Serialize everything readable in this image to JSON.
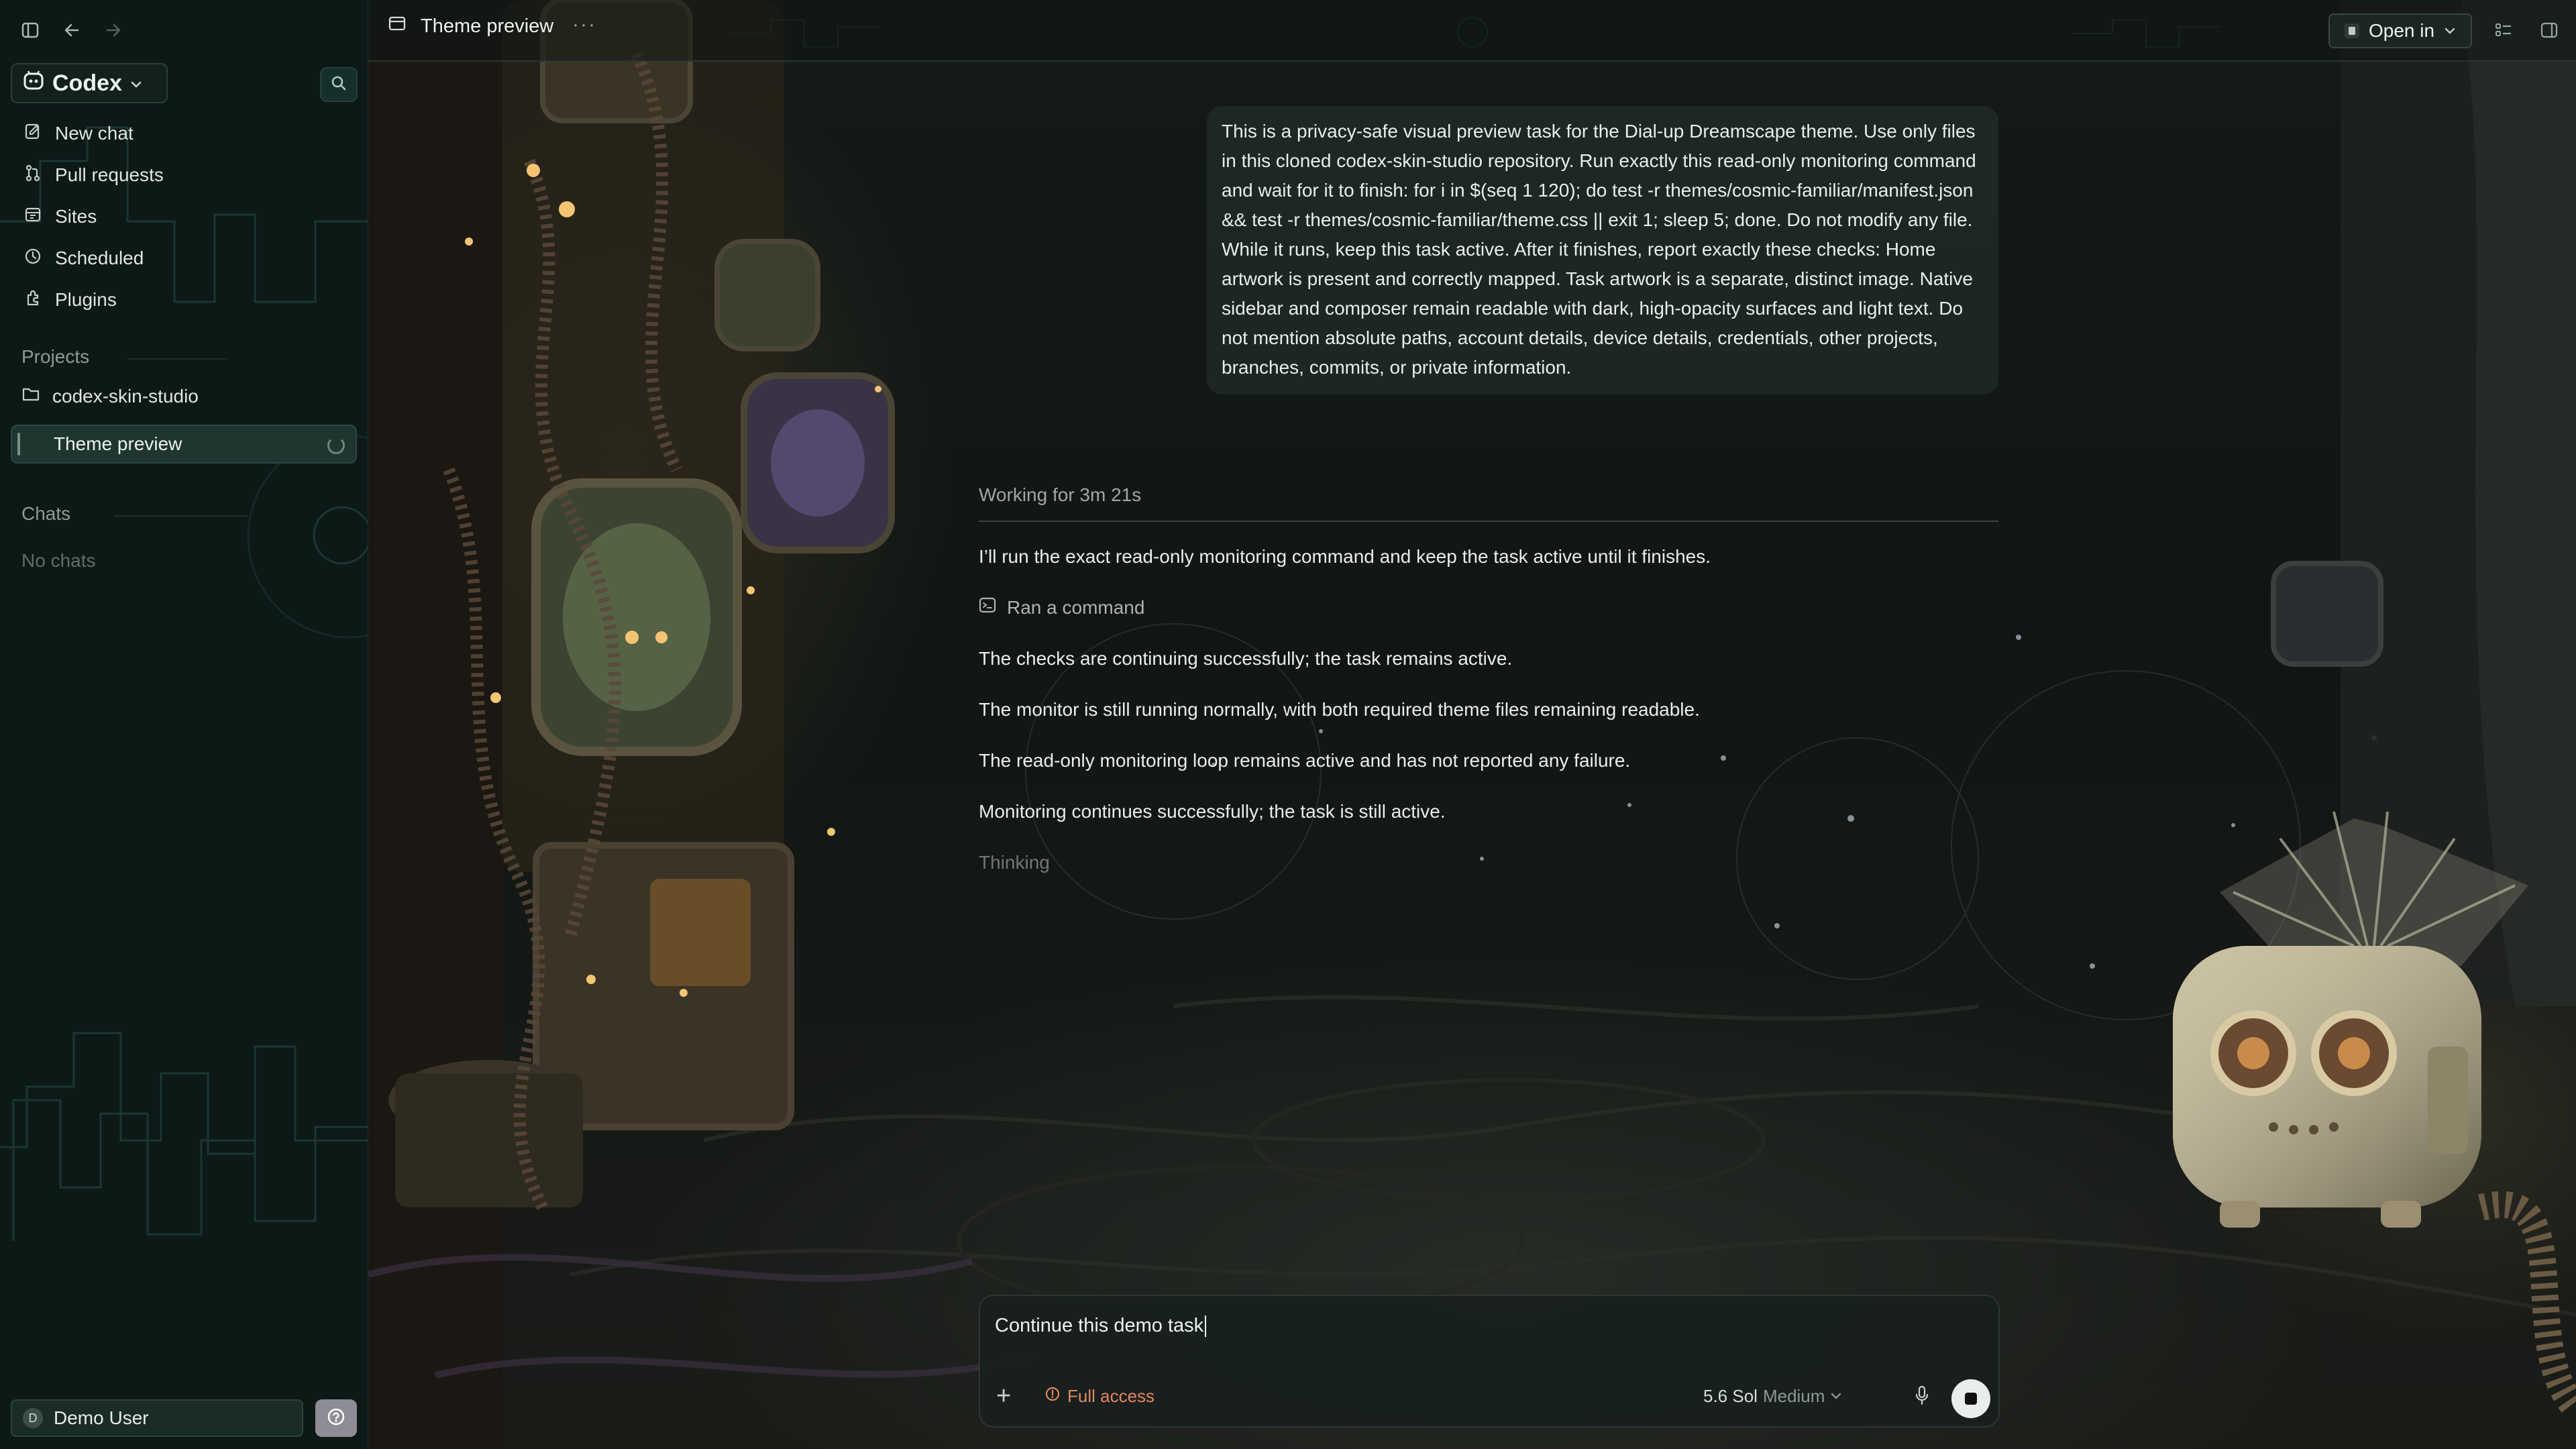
{
  "sidebar": {
    "app_name": "Codex",
    "nav": [
      {
        "label": "New chat",
        "icon": "compose-icon"
      },
      {
        "label": "Pull requests",
        "icon": "pull-request-icon"
      },
      {
        "label": "Sites",
        "icon": "sites-icon"
      },
      {
        "label": "Scheduled",
        "icon": "clock-icon"
      },
      {
        "label": "Plugins",
        "icon": "plugin-icon"
      }
    ],
    "projects_label": "Projects",
    "project_name": "codex-skin-studio",
    "active_thread": "Theme preview",
    "chats_label": "Chats",
    "no_chats": "No chats",
    "user_initial": "D",
    "user_name": "Demo User"
  },
  "header": {
    "title": "Theme preview",
    "more": "···",
    "open_in": "Open in"
  },
  "conversation": {
    "user_message": "This is a privacy-safe visual preview task for the Dial-up Dreamscape theme. Use only files in this cloned codex-skin-studio repository. Run exactly this read-only monitoring command and wait for it to finish: for i in $(seq 1 120); do test -r themes/cosmic-familiar/manifest.json && test -r themes/cosmic-familiar/theme.css || exit 1; sleep 5; done. Do not modify any file. While it runs, keep this task active. After it finishes, report exactly these checks: Home artwork is present and correctly mapped. Task artwork is a separate, distinct image. Native sidebar and composer remain readable with dark, high-opacity surfaces and light text. Do not mention absolute paths, account details, device details, credentials, other projects, branches, commits, or private information.",
    "working_status": "Working for 3m 21s",
    "messages": [
      "I’ll run the exact read-only monitoring command and keep the task active until it finishes.",
      "The checks are continuing successfully; the task remains active.",
      "The monitor is still running normally, with both required theme files remaining readable.",
      "The read-only monitoring loop remains active and has not reported any failure.",
      "Monitoring continues successfully; the task is still active."
    ],
    "ran_command": "Ran a command",
    "thinking": "Thinking"
  },
  "composer": {
    "value": "Continue this demo task",
    "access": "Full access",
    "model": "5.6 Sol",
    "effort": "Medium",
    "access_color": "#e2885a"
  },
  "colors": {
    "sidebar_bg": "#0c1917",
    "active_item_bg": "#1f3530",
    "text": "#e9eeec"
  }
}
